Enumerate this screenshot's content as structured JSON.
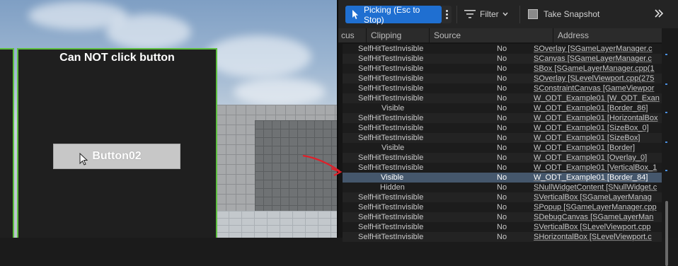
{
  "viewport": {
    "panel_title": "Can NOT click button",
    "button_label": "Button02"
  },
  "reflector": {
    "toolbar": {
      "picking_label": "Picking (Esc to Stop)",
      "filter_label": "Filter",
      "snapshot_label": "Take Snapshot"
    },
    "columns": [
      "cus",
      "Clipping",
      "Source",
      "Address"
    ],
    "rows": [
      {
        "visibility": "SelfHitTestInvisible",
        "clipping": "No",
        "address": "SOverlay [SGameLayerManager.c",
        "indent": 0
      },
      {
        "visibility": "SelfHitTestInvisible",
        "clipping": "No",
        "address": "SCanvas [SGameLayerManager.c",
        "indent": 0
      },
      {
        "visibility": "SelfHitTestInvisible",
        "clipping": "No",
        "address": "SBox [SGameLayerManager.cpp(1",
        "indent": 0
      },
      {
        "visibility": "SelfHitTestInvisible",
        "clipping": "No",
        "address": "SOverlay [SLevelViewport.cpp(275",
        "indent": 0
      },
      {
        "visibility": "SelfHitTestInvisible",
        "clipping": "No",
        "address": "SConstraintCanvas [GameViewpor",
        "indent": 0
      },
      {
        "visibility": "SelfHitTestInvisible",
        "clipping": "No",
        "address": "W_ODT_Example01 [W_ODT_Exan",
        "indent": 0
      },
      {
        "visibility": "Visible",
        "clipping": "No",
        "address": "W_ODT_Example01 [Border_86]",
        "indent": 1
      },
      {
        "visibility": "SelfHitTestInvisible",
        "clipping": "No",
        "address": "W_ODT_Example01 [HorizontalBox",
        "indent": 0
      },
      {
        "visibility": "SelfHitTestInvisible",
        "clipping": "No",
        "address": "W_ODT_Example01 [SizeBox_0]",
        "indent": 0
      },
      {
        "visibility": "SelfHitTestInvisible",
        "clipping": "No",
        "address": "W_ODT_Example01 [SizeBox]",
        "indent": 0
      },
      {
        "visibility": "Visible",
        "clipping": "No",
        "address": "W_ODT_Example01 [Border]",
        "indent": 1
      },
      {
        "visibility": "SelfHitTestInvisible",
        "clipping": "No",
        "address": "W_ODT_Example01 [Overlay_0]",
        "indent": 0
      },
      {
        "visibility": "SelfHitTestInvisible",
        "clipping": "No",
        "address": "W_ODT_Example01 [VerticalBox_1",
        "indent": 0
      },
      {
        "visibility": "Visible",
        "clipping": "No",
        "address": "W_ODT_Example01 [Border_84]",
        "indent": 2,
        "selected": true
      },
      {
        "visibility": "Hidden",
        "clipping": "No",
        "address": "SNullWidgetContent [SNullWidget.c",
        "indent": 1
      },
      {
        "visibility": "SelfHitTestInvisible",
        "clipping": "No",
        "address": "SVerticalBox [SGameLayerManag",
        "indent": 0
      },
      {
        "visibility": "SelfHitTestInvisible",
        "clipping": "No",
        "address": "SPopup [SGameLayerManager.cpp",
        "indent": 0
      },
      {
        "visibility": "SelfHitTestInvisible",
        "clipping": "No",
        "address": "SDebugCanvas [SGameLayerMan",
        "indent": 0
      },
      {
        "visibility": "SelfHitTestInvisible",
        "clipping": "No",
        "address": "SVerticalBox [SLevelViewport.cpp",
        "indent": 0
      },
      {
        "visibility": "SelfHitTestInvisible",
        "clipping": "No",
        "address": "SHorizontalBox [SLevelViewport.c",
        "indent": 0
      }
    ]
  },
  "colors": {
    "picking_accent": "#1f6fd1",
    "panel_border": "#5dbf3f",
    "selected_row": "#45576c",
    "annotation_arrow": "#e0202a"
  },
  "icons": [
    "cursor-icon",
    "picking-icon",
    "more-icon",
    "filter-icon",
    "chevron-down-icon",
    "snapshot-icon",
    "expand-icon"
  ]
}
